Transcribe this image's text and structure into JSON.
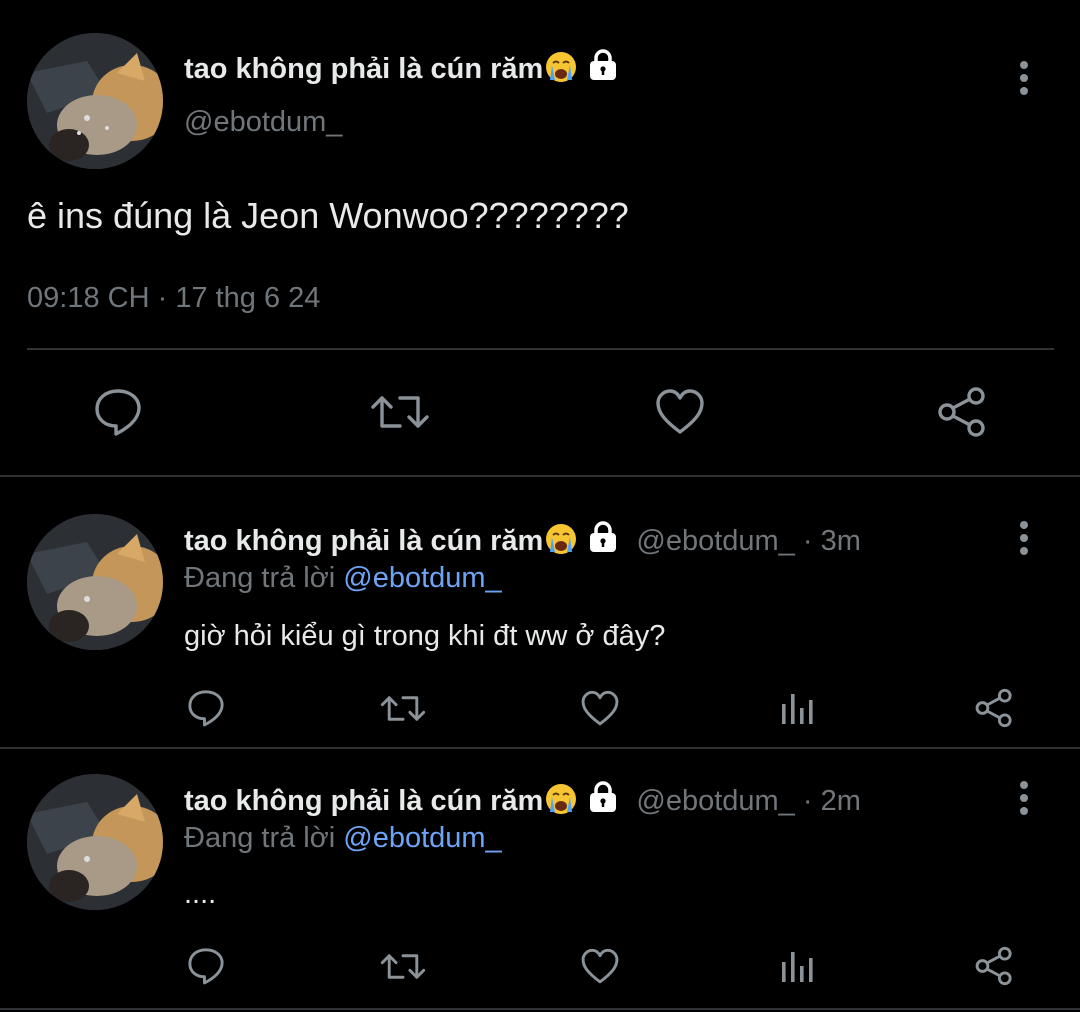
{
  "main_tweet": {
    "author_name": "tao không phải là cún răm",
    "author_emoji": "crying-face-emoji",
    "protected": "lock-icon",
    "handle": "@ebotdum_",
    "text": "ê ins đúng là Jeon Wonwoo????????",
    "time": "09:18 CH",
    "separator": "·",
    "date": "17 thg 6 24",
    "actions": [
      "reply-icon",
      "retweet-icon",
      "like-icon",
      "share-icon"
    ]
  },
  "replies": [
    {
      "author_name": "tao không phải là cún răm",
      "handle": "@ebotdum_",
      "separator": "·",
      "age": "3m",
      "replying_label": "Đang trả lời",
      "replying_mention": "@ebotdum_",
      "text": "giờ hỏi kiểu gì trong khi đt ww ở đây?"
    },
    {
      "author_name": "tao không phải là cún răm",
      "handle": "@ebotdum_",
      "separator": "·",
      "age": "2m",
      "replying_label": "Đang trả lời",
      "replying_mention": "@ebotdum_",
      "text": "...."
    }
  ],
  "colors": {
    "background": "#000000",
    "text_primary": "#e7e9ea",
    "text_secondary": "#71767b",
    "link": "#6ea4f5",
    "divider": "#2f3336",
    "icon": "#8b9298"
  }
}
